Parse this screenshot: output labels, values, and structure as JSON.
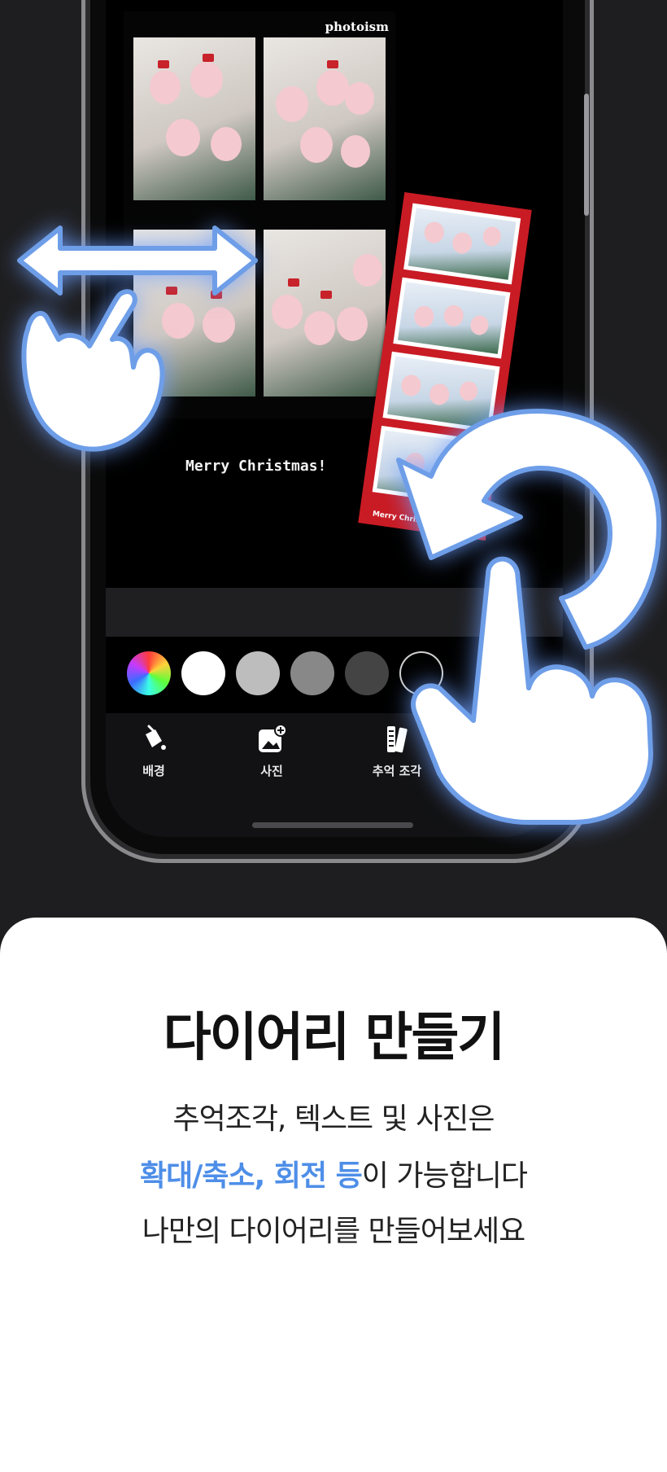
{
  "diary_screen": {
    "brand": "photoism",
    "caption": "Merry Christmas!",
    "strip_text": "Merry Christmas"
  },
  "color_swatches": [
    {
      "name": "color-wheel",
      "color": "conic"
    },
    {
      "name": "white",
      "color": "#ffffff"
    },
    {
      "name": "light-gray",
      "color": "#bdbdbd"
    },
    {
      "name": "gray",
      "color": "#888888"
    },
    {
      "name": "dark-gray",
      "color": "#444444"
    },
    {
      "name": "black",
      "color": "#000000"
    }
  ],
  "toolbar": {
    "background_label": "배경",
    "photo_label": "사진",
    "memory_piece_label": "추억 조각"
  },
  "card": {
    "title": "다이어리 만들기",
    "line1": "추억조각, 텍스트 및 사진은",
    "line2_highlight": "확대/축소, 회전 등",
    "line2_rest": "이 가능합니다",
    "line3": "나만의 다이어리를 만들어보세요"
  },
  "colors": {
    "accent": "#4e8ee8",
    "strip_red": "#c91b24",
    "glow": "#6ea0ff"
  }
}
